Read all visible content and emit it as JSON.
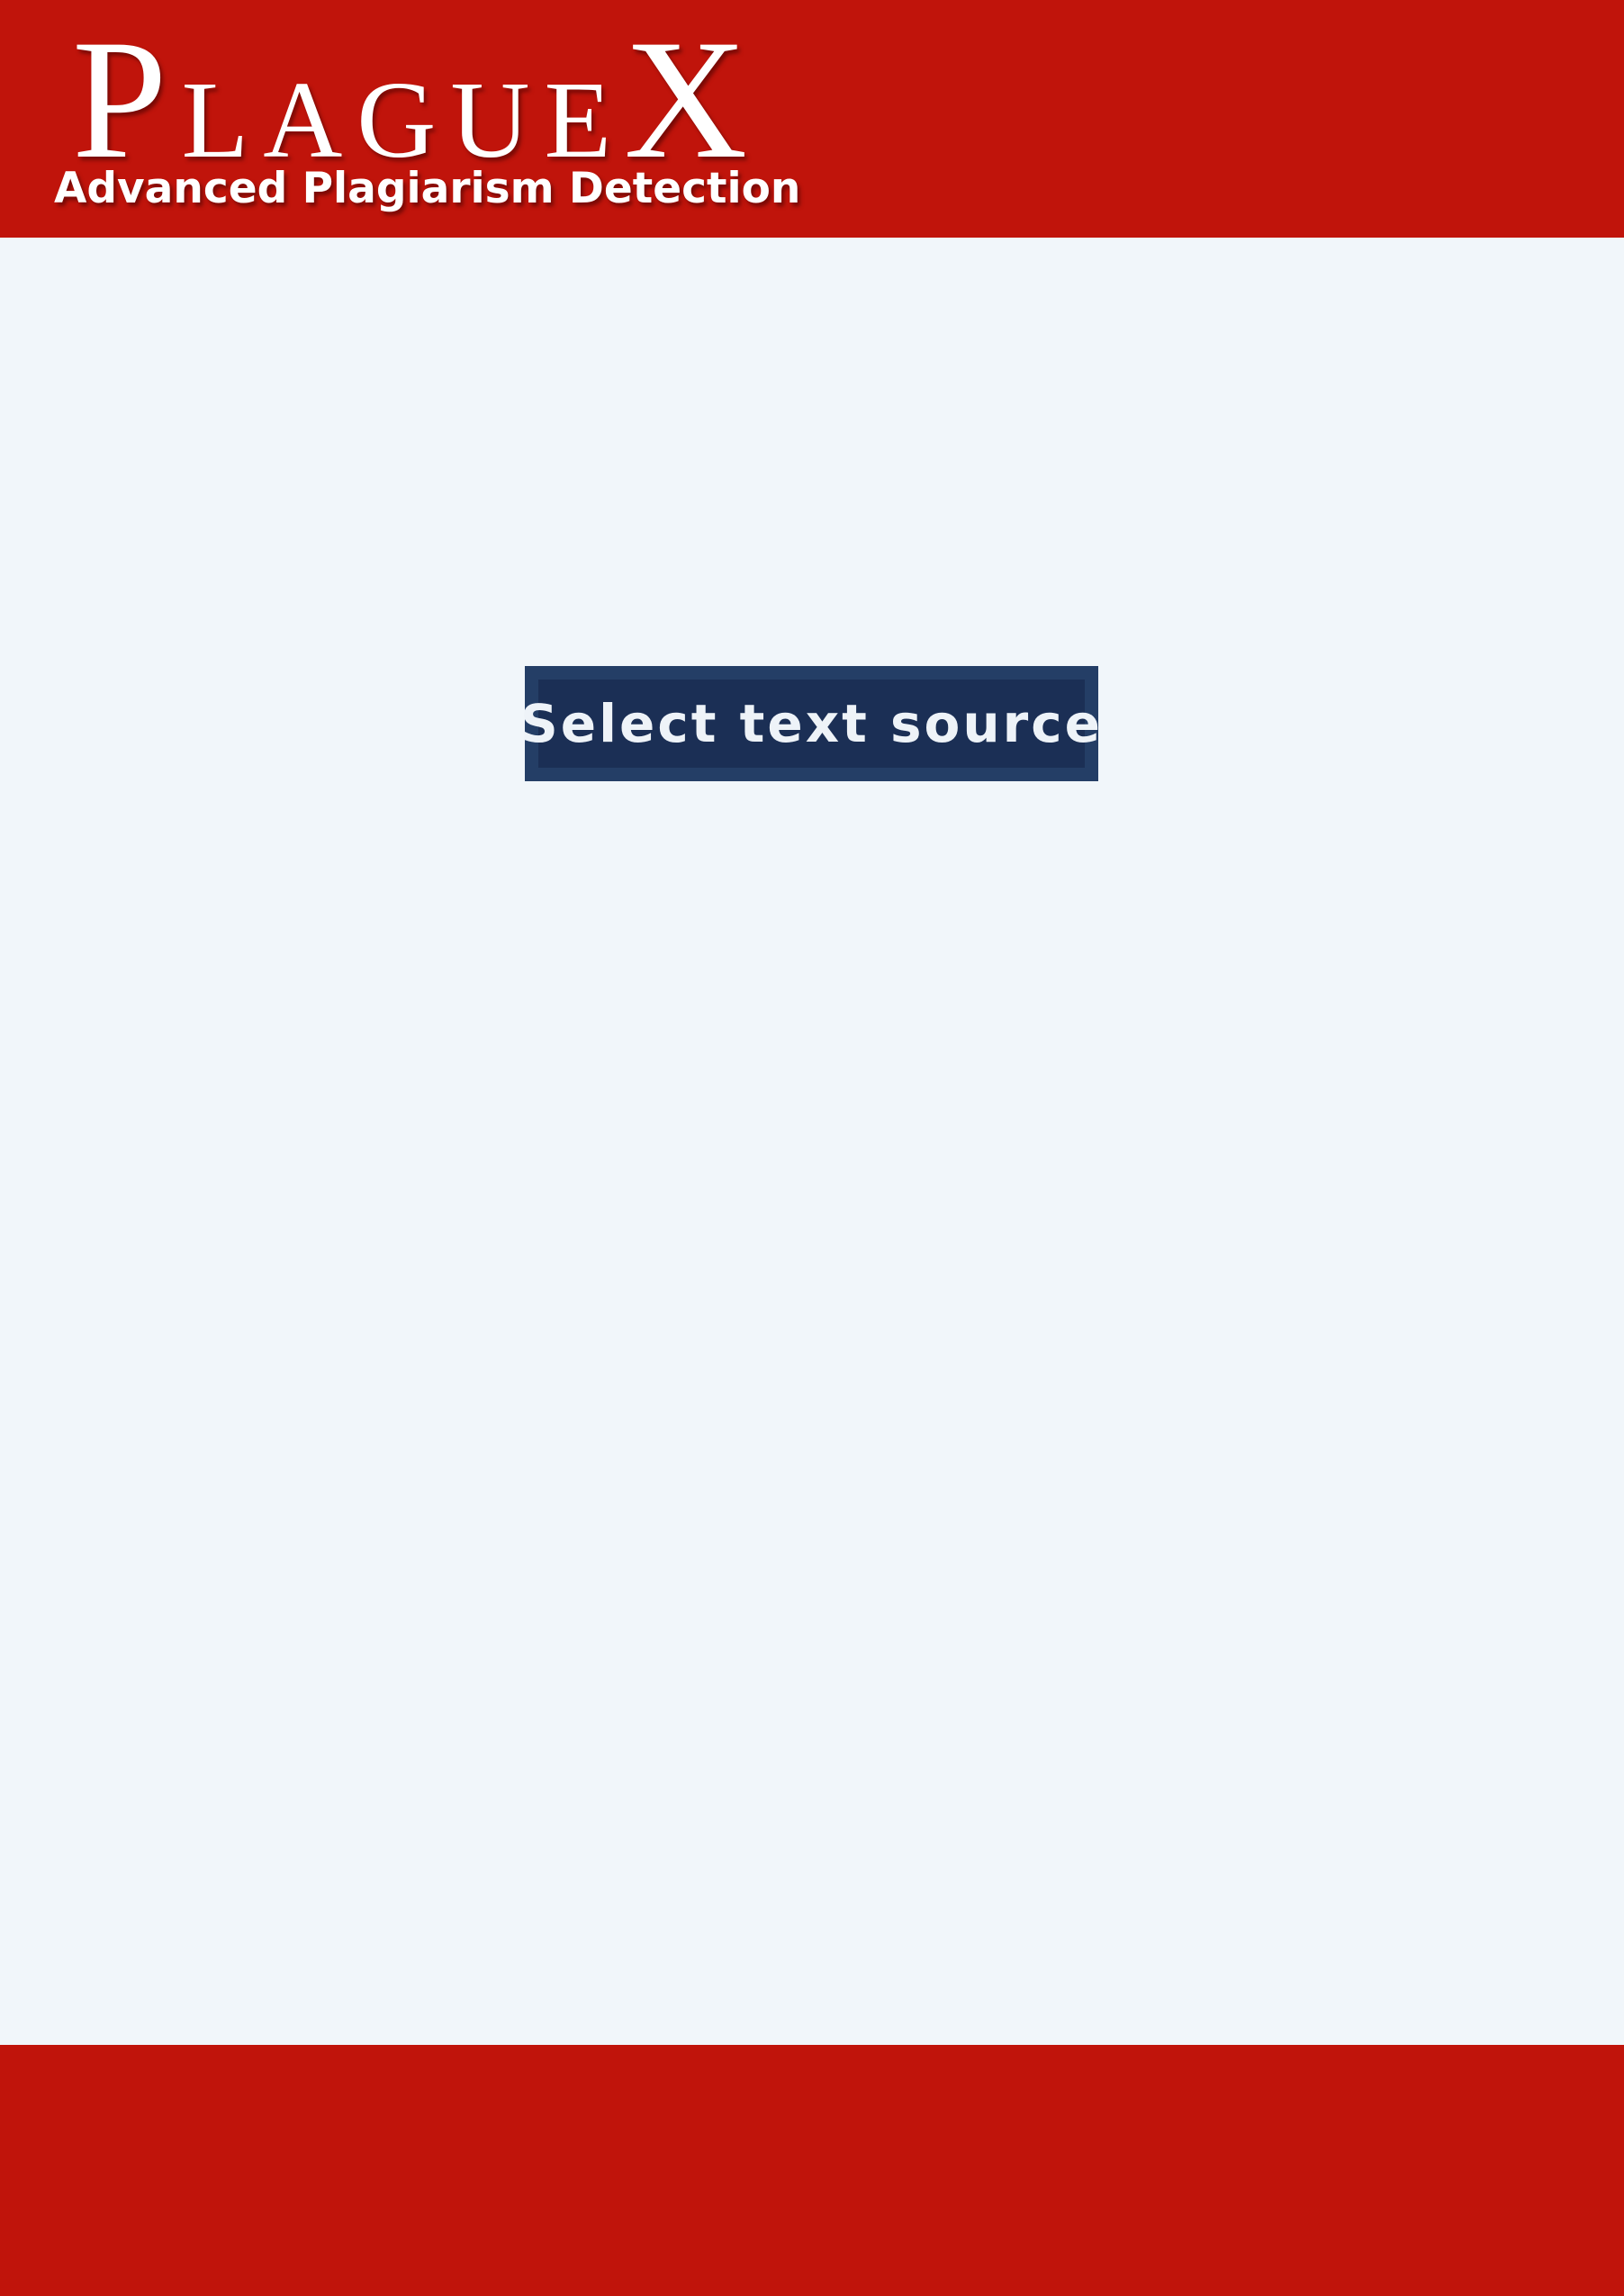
{
  "header": {
    "logo": {
      "text": "PlagueX",
      "first_letter": "P",
      "middle": "LAGUE",
      "last_letter": "X"
    },
    "tagline": "Advanced Plagiarism Detection"
  },
  "main": {
    "source_button_label": "Select text source"
  },
  "colors": {
    "brand_red": "#c0140b",
    "background": "#f1f6fa",
    "button_border": "#243e66",
    "button_fill": "#1b2f55",
    "button_text": "#eef3f8"
  }
}
